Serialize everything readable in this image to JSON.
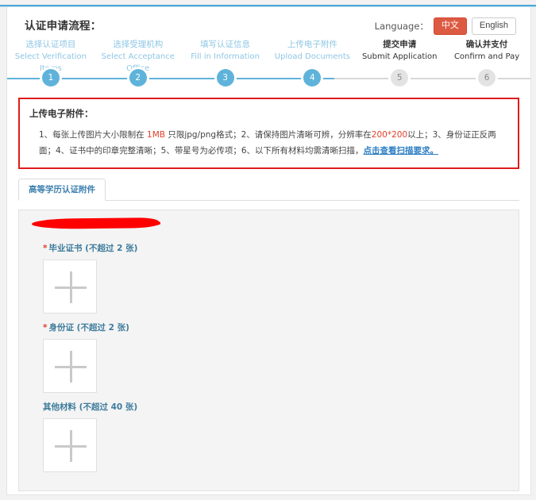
{
  "header": {
    "title": "认证申请流程：",
    "language_label": "Language：",
    "lang_cn": "中文",
    "lang_en": "English"
  },
  "stepper": {
    "steps": [
      {
        "num": "1",
        "cn": "选择认证项目",
        "en": "Select Verification Items",
        "state": "done"
      },
      {
        "num": "2",
        "cn": "选择受理机构",
        "en": "Select Acceptance Office",
        "state": "done"
      },
      {
        "num": "3",
        "cn": "填写认证信息",
        "en": "Fill in Information",
        "state": "done"
      },
      {
        "num": "4",
        "cn": "上传电子附件",
        "en": "Upload Documents",
        "state": "done"
      },
      {
        "num": "5",
        "cn": "提交申请",
        "en": "Submit Application",
        "state": "todo"
      },
      {
        "num": "6",
        "cn": "确认并支付",
        "en": "Confirm and Pay",
        "state": "todo"
      }
    ],
    "active_color": "#5fb3da",
    "inactive_color": "#e3e3e3"
  },
  "notice": {
    "title": "上传电子附件：",
    "line1_a": "1、每张上传图片大小限制在 ",
    "line1_size": "1MB",
    "line1_b": " 只限jpg/png格式；2、请保持图片清晰可辨，分辨率在",
    "line1_res": "200*200",
    "line1_c": "以上；3、身份证正反两面；4、证书中的印章",
    "line2_a": "完整清晰；5、带星号为必传项；6、以下所有材料均需清晰扫描，",
    "line2_link": "点击查看扫描要求。",
    "border_color": "#e01b1b",
    "highlight_red": "#e0402a",
    "highlight_blue": "#2f7fc4"
  },
  "tabs": [
    {
      "label": "高等学历认证附件",
      "active": true
    }
  ],
  "upload": {
    "groups": [
      {
        "required": true,
        "star": "*",
        "label": "毕业证书 (不超过 2 张)",
        "icon": "plus-icon"
      },
      {
        "required": true,
        "star": "*",
        "label": "身份证 (不超过 2 张)",
        "icon": "plus-icon"
      },
      {
        "required": false,
        "star": "",
        "label": "其他材料 (不超过 40 张)",
        "icon": "plus-icon"
      }
    ]
  }
}
